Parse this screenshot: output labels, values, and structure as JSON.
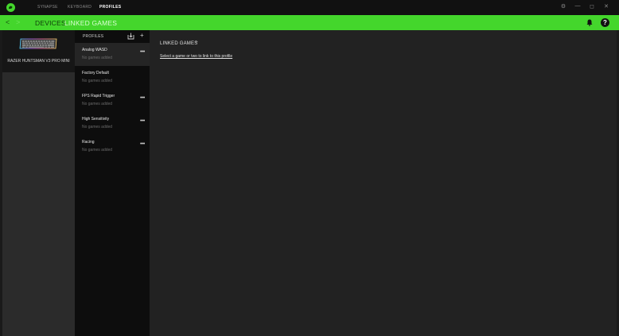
{
  "titlebar": {
    "tabs": [
      {
        "label": "SYNAPSE"
      },
      {
        "label": "KEYBOARD"
      },
      {
        "label": "PROFILES"
      }
    ],
    "controls": {
      "settings": "⚙",
      "minimize": "—",
      "maximize": "◻",
      "close": "✕"
    }
  },
  "header": {
    "back": "<",
    "forward": ">",
    "tabs": [
      {
        "label": "DEVICES"
      },
      {
        "label": "LINKED GAMES"
      }
    ],
    "help": "?"
  },
  "device": {
    "name": "RAZER HUNTSMAN V3 PRO MINI"
  },
  "profiles": {
    "header": "PROFILES",
    "add": "+",
    "more": "•••",
    "items": [
      {
        "name": "Analog WASD",
        "sub": "No games added"
      },
      {
        "name": "Factory Default",
        "sub": "No games added"
      },
      {
        "name": "FPS Rapid Trigger",
        "sub": "No games added"
      },
      {
        "name": "High Sensitivity",
        "sub": "No games added"
      },
      {
        "name": "Racing",
        "sub": "No games added"
      }
    ]
  },
  "main": {
    "title": "LINKED GAMES",
    "add": "+",
    "link_text": "Select a game or two to link to this profile"
  },
  "colors": {
    "accent": "#44d62c",
    "titlebar": "#111111",
    "profiles_bg": "#0d0d0d",
    "main_bg": "#222222"
  }
}
